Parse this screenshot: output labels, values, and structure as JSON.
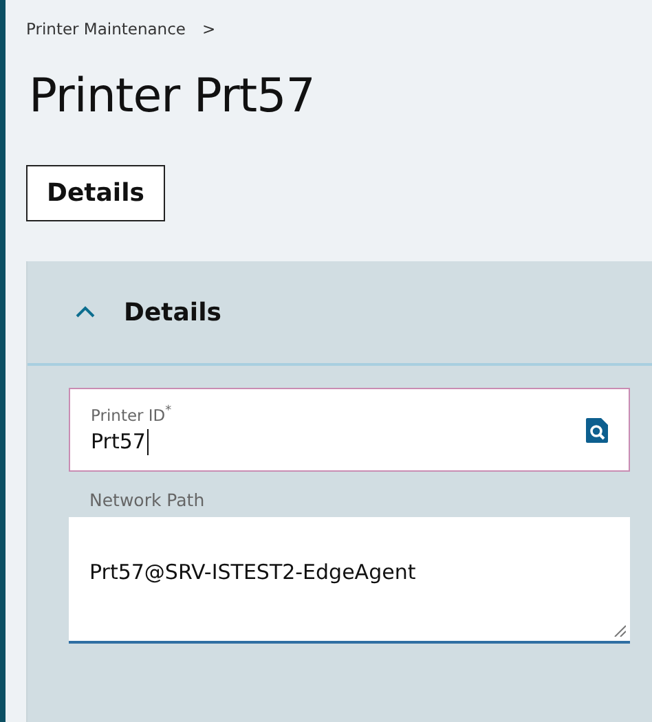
{
  "breadcrumb": {
    "items": [
      "Printer Maintenance"
    ],
    "separator": ">"
  },
  "title": "Printer Prt57",
  "tabs": [
    {
      "label": "Details",
      "selected": true
    }
  ],
  "section": {
    "title": "Details",
    "expanded": true,
    "fields": [
      {
        "kind": "lookup",
        "label": "Printer ID",
        "required": true,
        "required_mark": "*",
        "value": "Prt57",
        "focused": true
      },
      {
        "kind": "textarea",
        "label": "Network Path",
        "required": false,
        "value": "Prt57@SRV-ISTEST2-EdgeAgent",
        "focused": false
      }
    ]
  }
}
